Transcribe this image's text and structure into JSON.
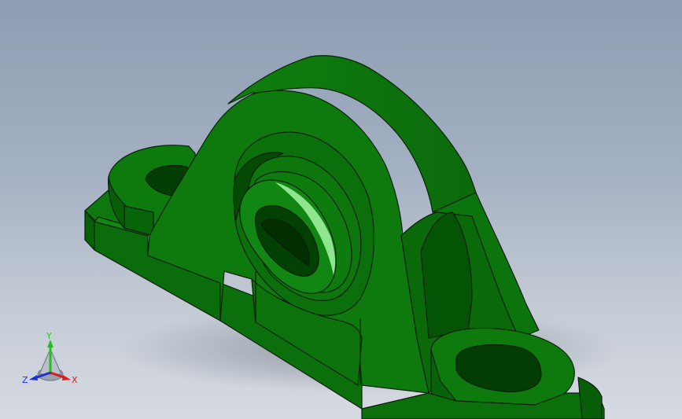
{
  "viewport": {
    "background_top": "#8e9db2",
    "background_bottom": "#d6dae1"
  },
  "model": {
    "part": "pillow-block-bearing",
    "colors": {
      "base": "#0e7a0e",
      "light": "#1f9c1f",
      "dark": "#055a05",
      "darker": "#033d03",
      "edge": "#0a200a",
      "highlight": "#8fe68f"
    }
  },
  "triad": {
    "x_label": "X",
    "y_label": "Y",
    "z_label": "Z",
    "x_color": "#d81e1e",
    "y_color": "#1ec21e",
    "z_color": "#1e2ed8"
  }
}
